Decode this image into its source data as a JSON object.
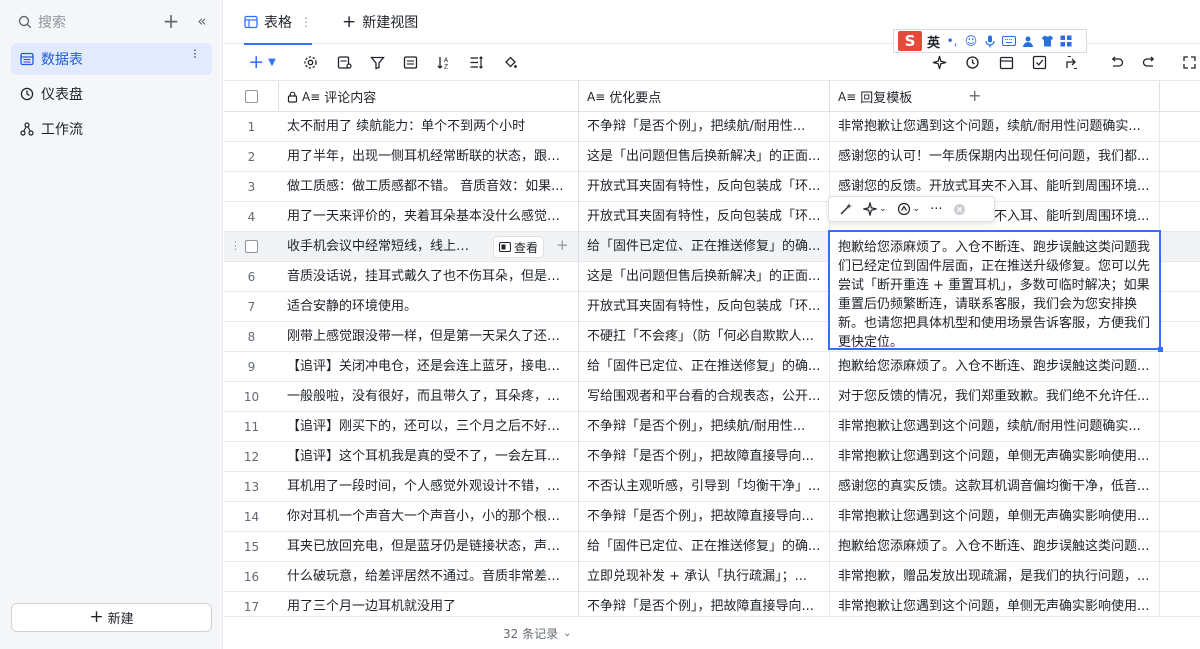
{
  "sidebar": {
    "search_label": "搜索",
    "items": [
      {
        "label": "数据表",
        "icon": "table-icon",
        "active": true
      },
      {
        "label": "仪表盘",
        "icon": "dashboard-icon",
        "active": false
      },
      {
        "label": "工作流",
        "icon": "workflow-icon",
        "active": false
      }
    ],
    "new_label": "新建"
  },
  "tabs": {
    "active_label": "表格",
    "new_view_label": "新建视图"
  },
  "ime": {
    "logo": "S",
    "mode": "英"
  },
  "columns": [
    {
      "label": "评论内容",
      "icon": "text-field-icon"
    },
    {
      "label": "优化要点",
      "icon": "text-field-icon"
    },
    {
      "label": "回复模板",
      "icon": "text-field-icon"
    }
  ],
  "rows": [
    {
      "num": "1",
      "comment": "太不耐用了 续航能力：单个不到两个小时",
      "point": "不争辩「是否个例」，把续航/耐用性...",
      "reply": "非常抱歉让您遇到这个问题，续航/耐用性问题确实..."
    },
    {
      "num": "2",
      "comment": "用了半年，出现一侧耳机经常断联的状态，跟客...",
      "point": "这是「出问题但售后换新解决」的正面...",
      "reply": "感谢您的认可！一年质保期内出现任何问题，我们都..."
    },
    {
      "num": "3",
      "comment": "做工质感：做工质感都不错。 音质音效：如果...",
      "point": "开放式耳夹固有特性，反向包装成「环...",
      "reply": "感谢您的反馈。开放式耳夹不入耳、能听到周围环境..."
    },
    {
      "num": "4",
      "comment": "用了一天来评价的，夹着耳朵基本没什么感觉，...",
      "point": "开放式耳夹固有特性，反向包装成「环...",
      "reply": "感谢您的反馈。开放式耳夹不入耳、能听到周围环境..."
    },
    {
      "num": "5",
      "comment": "收手机会议中经常短线，线上蓝牙还...",
      "point": "给「固件已定位、正在推送修复」的确...",
      "reply": "抱歉给您添麻烦了。入仓不断连、跑步误触这类问题我们已经定位到固件层面，正在推送升级修复。您可以先尝试「断开重连 + 重置耳机」，多数可临时解决；如果重置后仍频繁断连，请联系客服，我们会为您安排换新。也请您把具体机型和使用场景告诉客服，方便我们更快定位。"
    },
    {
      "num": "6",
      "comment": "音质没话说，挂耳式戴久了也不伤耳朵，但是七...",
      "point": "这是「出问题但售后换新解决」的正面...",
      "reply": "感谢您的认可！一年质保期内出现任何问题，我们都..."
    },
    {
      "num": "7",
      "comment": "适合安静的环境使用。",
      "point": "开放式耳夹固有特性，反向包装成「环...",
      "reply": "感谢您的反馈。开放式耳夹不入耳、能听到周围环境..."
    },
    {
      "num": "8",
      "comment": "刚带上感觉跟没带一样，但是第一天呆久了还是...",
      "point": "不硬扛「不会疼」（防「何必自欺欺人...",
      "reply": "感谢您的真实反馈。每个人耳廓形状不同，长时间佩..."
    },
    {
      "num": "9",
      "comment": "【追评】关闭冲电仓，还是会连上蓝牙，接电话...",
      "point": "给「固件已定位、正在推送修复」的确...",
      "reply": "抱歉给您添麻烦了。入仓不断连、跑步误触这类问题..."
    },
    {
      "num": "10",
      "comment": "一般般啦，没有很好，而且带久了，耳朵疼，蓝...",
      "point": "写给围观者和平台看的合规表态，公开...",
      "reply": "对于您反馈的情况，我们郑重致歉。我们绝不允许任..."
    },
    {
      "num": "11",
      "comment": "【追评】刚买下的，还可以，三个月之后不好用...",
      "point": "不争辩「是否个例」，把续航/耐用性...",
      "reply": "非常抱歉让您遇到这个问题，续航/耐用性问题确实..."
    },
    {
      "num": "12",
      "comment": "【追评】这个耳机我是真的受不了，一会左耳不...",
      "point": "不争辩「是否个例」，把故障直接导向...",
      "reply": "非常抱歉让您遇到这个问题，单侧无声确实影响使用..."
    },
    {
      "num": "13",
      "comment": "耳机用了一段时间，个人感觉外观设计不错，待...",
      "point": "不否认主观听感，引导到「均衡干净」...",
      "reply": "感谢您的真实反馈。这款耳机调音偏均衡干净，低音..."
    },
    {
      "num": "14",
      "comment": "你对耳机一个声音大一个声音小，小的那个根本...",
      "point": "不争辩「是否个例」，把故障直接导向...",
      "reply": "非常抱歉让您遇到这个问题，单侧无声确实影响使用..."
    },
    {
      "num": "15",
      "comment": "耳夹已放回充电，但是蓝牙仍是链接状态，声音...",
      "point": "给「固件已定位、正在推送修复」的确...",
      "reply": "抱歉给您添麻烦了。入仓不断连、跑步误触这类问题..."
    },
    {
      "num": "16",
      "comment": "什么破玩意，给差评居然不通过。音质非常差，...",
      "point": "立即兑现补发 + 承认「执行疏漏」；...",
      "reply": "非常抱歉，赠品发放出现疏漏，是我们的执行问题，..."
    },
    {
      "num": "17",
      "comment": "用了三个月一边耳机就没用了",
      "point": "不争辩「是否个例」，把故障直接导向...",
      "reply": "非常抱歉让您遇到这个问题，单侧无声确实影响使用..."
    }
  ],
  "view_button_label": "查看",
  "footer": {
    "records_label": "32 条记录"
  }
}
